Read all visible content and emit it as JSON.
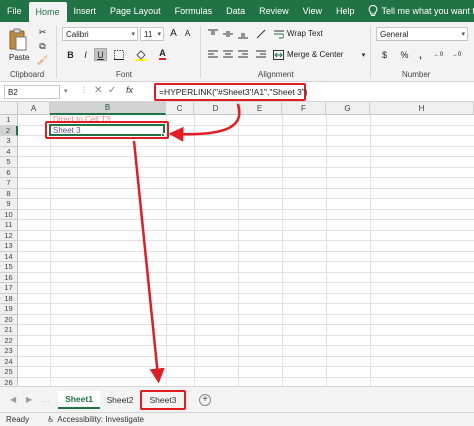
{
  "tabs": [
    "File",
    "Home",
    "Insert",
    "Page Layout",
    "Formulas",
    "Data",
    "Review",
    "View",
    "Help"
  ],
  "active_tab": "Home",
  "tell_me": "Tell me what you want to do",
  "clipboard": {
    "paste_label": "Paste",
    "group": "Clipboard"
  },
  "font": {
    "name": "Calibri",
    "size": "11",
    "bold": "B",
    "italic": "I",
    "underline": "U",
    "grow": "A",
    "shrink": "A",
    "color_letter": "A",
    "group": "Font"
  },
  "alignment": {
    "wrap_text": "Wrap Text",
    "merge_center": "Merge & Center",
    "group": "Alignment"
  },
  "number": {
    "format": "General",
    "currency": "$",
    "percent": "%",
    "comma": ",",
    "group": "Number"
  },
  "formula_bar": {
    "name_box": "B2",
    "fx": "fx",
    "formula": "=HYPERLINK(\"#Sheet3'!A1\",\"Sheet 3\")"
  },
  "grid": {
    "columns": [
      "A",
      "B",
      "C",
      "D",
      "E",
      "F",
      "G",
      "H"
    ],
    "rows": [
      "1",
      "2",
      "3",
      "4",
      "5",
      "6",
      "7",
      "8",
      "9",
      "10",
      "11",
      "12",
      "13",
      "14",
      "15",
      "16",
      "17",
      "18",
      "19",
      "20",
      "21",
      "22",
      "23",
      "24",
      "25",
      "26"
    ],
    "selected_column": "B",
    "selected_row": "2",
    "b1_text": "Direct to Cell T3",
    "b2_text": "Sheet 3"
  },
  "sheets": [
    "Sheet1",
    "Sheet2",
    "Sheet3"
  ],
  "active_sheet": "Sheet1",
  "highlighted_sheet": "Sheet3",
  "status": {
    "ready": "Ready",
    "accessibility": "Accessibility: Investigate"
  },
  "colors": {
    "excel_green": "#217346",
    "annotation_red": "#e31c23",
    "hyperlink": "#6b4a8a"
  }
}
